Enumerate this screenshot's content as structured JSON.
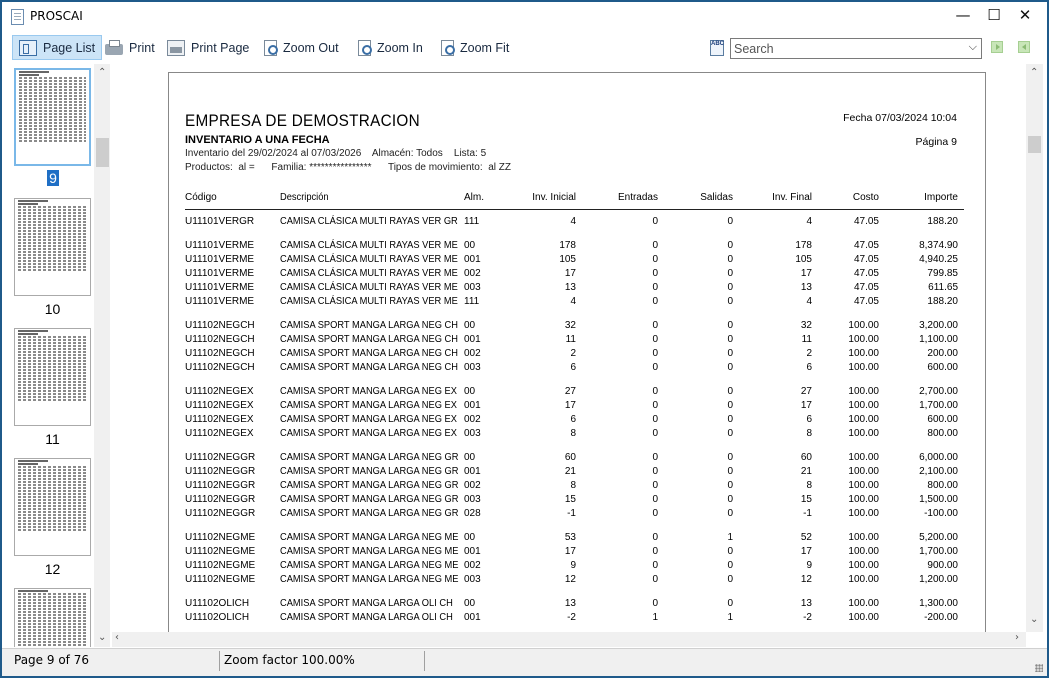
{
  "window": {
    "title": "PROSCAI",
    "min": "—",
    "max": "☐",
    "close": "✕"
  },
  "toolbar": {
    "page_list": "Page List",
    "print": "Print",
    "print_page": "Print Page",
    "zoom_out": "Zoom Out",
    "zoom_in": "Zoom In",
    "zoom_fit": "Zoom Fit",
    "spell_icon_text": "ABC",
    "search_value": "Search"
  },
  "thumbnails": [
    {
      "label": "9",
      "selected": true
    },
    {
      "label": "10",
      "selected": false
    },
    {
      "label": "11",
      "selected": false
    },
    {
      "label": "12",
      "selected": false
    }
  ],
  "report": {
    "company": "EMPRESA DE DEMOSTRACION",
    "title": "INVENTARIO A UNA FECHA",
    "line1": "Inventario del 29/02/2024 al 07/03/2026    Almacén: Todos    Lista: 5",
    "line2": "Productos:  al =      Familia: ****************      Tipos de movimiento:  al ZZ",
    "date": "Fecha 07/03/2024 10:04",
    "page": "Página 9",
    "headers": {
      "codigo": "Código",
      "descripcion": "Descripción",
      "alm": "Alm.",
      "inv_inicial": "Inv. Inicial",
      "entradas": "Entradas",
      "salidas": "Salidas",
      "inv_final": "Inv. Final",
      "costo": "Costo",
      "importe": "Importe"
    },
    "rows": [
      [
        "U11101VERGR",
        "CAMISA CLÁSICA MULTI RAYAS VER GR",
        "111",
        "4",
        "0",
        "0",
        "4",
        "47.05",
        "188.20"
      ],
      [
        "U11101VERME",
        "CAMISA CLÁSICA MULTI RAYAS VER ME",
        "00",
        "178",
        "0",
        "0",
        "178",
        "47.05",
        "8,374.90"
      ],
      [
        "U11101VERME",
        "CAMISA CLÁSICA MULTI RAYAS VER ME",
        "001",
        "105",
        "0",
        "0",
        "105",
        "47.05",
        "4,940.25"
      ],
      [
        "U11101VERME",
        "CAMISA CLÁSICA MULTI RAYAS VER ME",
        "002",
        "17",
        "0",
        "0",
        "17",
        "47.05",
        "799.85"
      ],
      [
        "U11101VERME",
        "CAMISA CLÁSICA MULTI RAYAS VER ME",
        "003",
        "13",
        "0",
        "0",
        "13",
        "47.05",
        "611.65"
      ],
      [
        "U11101VERME",
        "CAMISA CLÁSICA MULTI RAYAS VER ME",
        "111",
        "4",
        "0",
        "0",
        "4",
        "47.05",
        "188.20"
      ],
      [
        "U11102NEGCH",
        "CAMISA SPORT MANGA LARGA NEG CH",
        "00",
        "32",
        "0",
        "0",
        "32",
        "100.00",
        "3,200.00"
      ],
      [
        "U11102NEGCH",
        "CAMISA SPORT MANGA LARGA NEG CH",
        "001",
        "11",
        "0",
        "0",
        "11",
        "100.00",
        "1,100.00"
      ],
      [
        "U11102NEGCH",
        "CAMISA SPORT MANGA LARGA NEG CH",
        "002",
        "2",
        "0",
        "0",
        "2",
        "100.00",
        "200.00"
      ],
      [
        "U11102NEGCH",
        "CAMISA SPORT MANGA LARGA NEG CH",
        "003",
        "6",
        "0",
        "0",
        "6",
        "100.00",
        "600.00"
      ],
      [
        "U11102NEGEX",
        "CAMISA SPORT MANGA LARGA NEG EX",
        "00",
        "27",
        "0",
        "0",
        "27",
        "100.00",
        "2,700.00"
      ],
      [
        "U11102NEGEX",
        "CAMISA SPORT MANGA LARGA NEG EX",
        "001",
        "17",
        "0",
        "0",
        "17",
        "100.00",
        "1,700.00"
      ],
      [
        "U11102NEGEX",
        "CAMISA SPORT MANGA LARGA NEG EX",
        "002",
        "6",
        "0",
        "0",
        "6",
        "100.00",
        "600.00"
      ],
      [
        "U11102NEGEX",
        "CAMISA SPORT MANGA LARGA NEG EX",
        "003",
        "8",
        "0",
        "0",
        "8",
        "100.00",
        "800.00"
      ],
      [
        "U11102NEGGR",
        "CAMISA SPORT MANGA LARGA NEG GR",
        "00",
        "60",
        "0",
        "0",
        "60",
        "100.00",
        "6,000.00"
      ],
      [
        "U11102NEGGR",
        "CAMISA SPORT MANGA LARGA NEG GR",
        "001",
        "21",
        "0",
        "0",
        "21",
        "100.00",
        "2,100.00"
      ],
      [
        "U11102NEGGR",
        "CAMISA SPORT MANGA LARGA NEG GR",
        "002",
        "8",
        "0",
        "0",
        "8",
        "100.00",
        "800.00"
      ],
      [
        "U11102NEGGR",
        "CAMISA SPORT MANGA LARGA NEG GR",
        "003",
        "15",
        "0",
        "0",
        "15",
        "100.00",
        "1,500.00"
      ],
      [
        "U11102NEGGR",
        "CAMISA SPORT MANGA LARGA NEG GR",
        "028",
        "-1",
        "0",
        "0",
        "-1",
        "100.00",
        "-100.00"
      ],
      [
        "U11102NEGME",
        "CAMISA SPORT MANGA LARGA NEG ME",
        "00",
        "53",
        "0",
        "1",
        "52",
        "100.00",
        "5,200.00"
      ],
      [
        "U11102NEGME",
        "CAMISA SPORT MANGA LARGA NEG ME",
        "001",
        "17",
        "0",
        "0",
        "17",
        "100.00",
        "1,700.00"
      ],
      [
        "U11102NEGME",
        "CAMISA SPORT MANGA LARGA NEG ME",
        "002",
        "9",
        "0",
        "0",
        "9",
        "100.00",
        "900.00"
      ],
      [
        "U11102NEGME",
        "CAMISA SPORT MANGA LARGA NEG ME",
        "003",
        "12",
        "0",
        "0",
        "12",
        "100.00",
        "1,200.00"
      ],
      [
        "U11102OLICH",
        "CAMISA SPORT MANGA LARGA OLI CH",
        "00",
        "13",
        "0",
        "0",
        "13",
        "100.00",
        "1,300.00"
      ],
      [
        "U11102OLICH",
        "CAMISA SPORT MANGA LARGA OLI CH",
        "001",
        "-2",
        "1",
        "1",
        "-2",
        "100.00",
        "-200.00"
      ]
    ]
  },
  "status": {
    "page": "Page 9 of 76",
    "zoom": "Zoom factor 100.00%"
  }
}
